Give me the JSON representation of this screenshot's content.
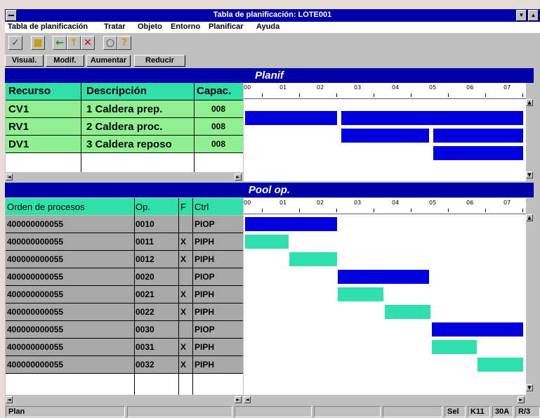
{
  "window": {
    "title": "Tabla de planificación: LOTE001"
  },
  "menu": [
    "Tabla de planificación",
    "Tratar",
    "Objeto",
    "Entorno",
    "Planificar",
    "Ayuda"
  ],
  "buttons": {
    "visual": "Visual.",
    "modif": "Modif.",
    "aumentar": "Aumentar",
    "reducir": "Reducir"
  },
  "toolbar_icons": [
    "check-icon",
    "save-icon",
    "back-arrow-icon",
    "up-arrow-icon",
    "cancel-icon",
    "find-icon",
    "help-icon"
  ],
  "planif": {
    "title": "Planif",
    "headers": {
      "recurso": "Recurso",
      "descripcion": "Descripción",
      "capac": "Capac."
    },
    "rows": [
      {
        "recurso": "CV1",
        "descripcion": "1 Caldera prep.",
        "capac": "008"
      },
      {
        "recurso": "RV1",
        "descripcion": "2 Caldera proc.",
        "capac": "008"
      },
      {
        "recurso": "DV1",
        "descripcion": "3 Caldera reposo",
        "capac": "008"
      }
    ]
  },
  "pool": {
    "title": "Pool op.",
    "headers": {
      "orden": "Orden de procesos",
      "op": "Op.",
      "f": "F",
      "ctrl": "Ctrl"
    },
    "rows": [
      {
        "orden": "400000000055",
        "op": "0010",
        "f": "",
        "ctrl": "PIOP"
      },
      {
        "orden": "400000000055",
        "op": "0011",
        "f": "X",
        "ctrl": "PIPH"
      },
      {
        "orden": "400000000055",
        "op": "0012",
        "f": "X",
        "ctrl": "PIPH"
      },
      {
        "orden": "400000000055",
        "op": "0020",
        "f": "",
        "ctrl": "PIOP"
      },
      {
        "orden": "400000000055",
        "op": "0021",
        "f": "X",
        "ctrl": "PIPH"
      },
      {
        "orden": "400000000055",
        "op": "0022",
        "f": "X",
        "ctrl": "PIPH"
      },
      {
        "orden": "400000000055",
        "op": "0030",
        "f": "",
        "ctrl": "PIOP"
      },
      {
        "orden": "400000000055",
        "op": "0031",
        "f": "X",
        "ctrl": "PIPH"
      },
      {
        "orden": "400000000055",
        "op": "0032",
        "f": "X",
        "ctrl": "PIPH"
      }
    ]
  },
  "timeline": {
    "ticks": [
      "00",
      "01",
      "02",
      "03",
      "04",
      "05",
      "06",
      "07"
    ]
  },
  "status": {
    "left": "Plan",
    "sel": "Sel",
    "k": "K11",
    "code": "30A",
    "r": "R/3"
  },
  "colors": {
    "blue": "#0000dd",
    "teal": "#30e0b0",
    "header": "#30e0a8",
    "resource": "#8ef08e"
  }
}
